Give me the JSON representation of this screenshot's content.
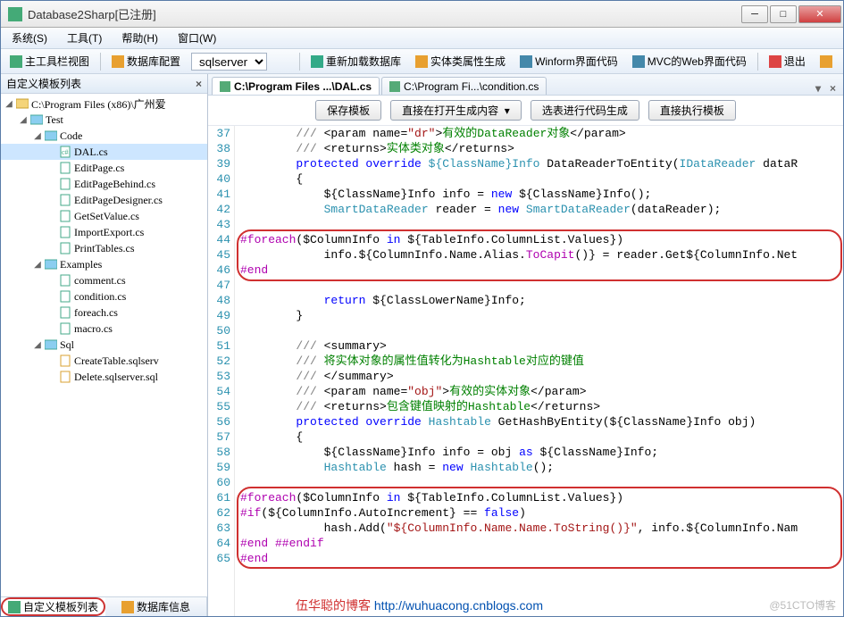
{
  "window": {
    "title": "Database2Sharp[已注册]"
  },
  "menu": [
    "系统(S)",
    "工具(T)",
    "帮助(H)",
    "窗口(W)"
  ],
  "toolbar": {
    "btn1": "主工具栏视图",
    "btn2": "数据库配置",
    "select": "sqlserver",
    "btn3": "重新加载数据库",
    "btn4": "实体类属性生成",
    "btn5": "Winform界面代码",
    "btn6": "MVC的Web界面代码",
    "btn7": "退出"
  },
  "sidebar": {
    "title": "自定义模板列表",
    "tree": {
      "root": "C:\\Program Files (x86)\\广州爱",
      "f1": "Test",
      "f2": "Code",
      "i1": "DAL.cs",
      "i2": "EditPage.cs",
      "i3": "EditPageBehind.cs",
      "i4": "EditPageDesigner.cs",
      "i5": "GetSetValue.cs",
      "i6": "ImportExport.cs",
      "i7": "PrintTables.cs",
      "f3": "Examples",
      "i8": "comment.cs",
      "i9": "condition.cs",
      "i10": "foreach.cs",
      "i11": "macro.cs",
      "f4": "Sql",
      "i12": "CreateTable.sqlserv",
      "i13": "Delete.sqlserver.sql"
    },
    "tab1": "自定义模板列表",
    "tab2": "数据库信息"
  },
  "tabs": {
    "t1": "C:\\Program Files ...\\DAL.cs",
    "t2": "C:\\Program Fi...\\condition.cs"
  },
  "buttons": {
    "b1": "保存模板",
    "b2": "直接在打开生成内容",
    "b3": "选表进行代码生成",
    "b4": "直接执行模板"
  },
  "code": {
    "start": 37,
    "lines": [
      {
        "seg": [
          [
            "        /// ",
            "c-gray"
          ],
          [
            "<param name=",
            ""
          ],
          [
            "\"dr\"",
            "c-str"
          ],
          [
            ">",
            ""
          ],
          [
            "有效的DataReader对象",
            "c-green"
          ],
          [
            "</param>",
            ""
          ]
        ]
      },
      {
        "seg": [
          [
            "        /// ",
            "c-gray"
          ],
          [
            "<returns>",
            ""
          ],
          [
            "实体类对象",
            "c-green"
          ],
          [
            "</returns>",
            ""
          ]
        ]
      },
      {
        "seg": [
          [
            "        ",
            ""
          ],
          [
            "protected override ",
            "c-blue"
          ],
          [
            "${ClassName}Info ",
            "c-type"
          ],
          [
            "DataReaderToEntity(",
            ""
          ],
          [
            "IDataReader ",
            "c-type"
          ],
          [
            "dataR",
            ""
          ]
        ]
      },
      {
        "seg": [
          [
            "        {",
            ""
          ]
        ]
      },
      {
        "seg": [
          [
            "            ${ClassName}Info info = ",
            ""
          ],
          [
            "new ",
            "c-blue"
          ],
          [
            "${ClassName}Info();",
            ""
          ]
        ]
      },
      {
        "seg": [
          [
            "            ",
            ""
          ],
          [
            "SmartDataReader ",
            "c-type"
          ],
          [
            "reader = ",
            ""
          ],
          [
            "new ",
            "c-blue"
          ],
          [
            "SmartDataReader",
            "c-type"
          ],
          [
            "(dataReader);",
            ""
          ]
        ]
      },
      {
        "seg": [
          [
            "",
            ""
          ]
        ]
      },
      {
        "seg": [
          [
            "#foreach",
            "c-mag"
          ],
          [
            "($ColumnInfo ",
            ""
          ],
          [
            "in ",
            "c-blue"
          ],
          [
            "${TableInfo.ColumnList.Values})",
            ""
          ]
        ]
      },
      {
        "seg": [
          [
            "            info.${ColumnInfo.Name.Alias.",
            ""
          ],
          [
            "ToCapit",
            "c-mag"
          ],
          [
            "()} = reader.Get${ColumnInfo.Net",
            ""
          ]
        ]
      },
      {
        "seg": [
          [
            "#end",
            "c-mag"
          ]
        ]
      },
      {
        "seg": [
          [
            "",
            ""
          ]
        ]
      },
      {
        "seg": [
          [
            "            ",
            ""
          ],
          [
            "return ",
            "c-blue"
          ],
          [
            "${ClassLowerName}Info;",
            ""
          ]
        ]
      },
      {
        "seg": [
          [
            "        }",
            ""
          ]
        ]
      },
      {
        "seg": [
          [
            "",
            ""
          ]
        ]
      },
      {
        "seg": [
          [
            "        /// ",
            "c-gray"
          ],
          [
            "<summary>",
            ""
          ]
        ]
      },
      {
        "seg": [
          [
            "        /// ",
            "c-gray"
          ],
          [
            "将实体对象的属性值转化为Hashtable对应的键值",
            "c-green"
          ]
        ]
      },
      {
        "seg": [
          [
            "        /// ",
            "c-gray"
          ],
          [
            "</summary>",
            ""
          ]
        ]
      },
      {
        "seg": [
          [
            "        /// ",
            "c-gray"
          ],
          [
            "<param name=",
            ""
          ],
          [
            "\"obj\"",
            "c-str"
          ],
          [
            ">",
            ""
          ],
          [
            "有效的实体对象",
            "c-green"
          ],
          [
            "</param>",
            ""
          ]
        ]
      },
      {
        "seg": [
          [
            "        /// ",
            "c-gray"
          ],
          [
            "<returns>",
            ""
          ],
          [
            "包含键值映射的Hashtable",
            "c-green"
          ],
          [
            "</returns>",
            ""
          ]
        ]
      },
      {
        "seg": [
          [
            "        ",
            ""
          ],
          [
            "protected override ",
            "c-blue"
          ],
          [
            "Hashtable ",
            "c-type"
          ],
          [
            "GetHashByEntity",
            ""
          ],
          [
            "(${ClassName}Info obj)",
            ""
          ]
        ]
      },
      {
        "seg": [
          [
            "        {",
            ""
          ]
        ]
      },
      {
        "seg": [
          [
            "            ${ClassName}Info info = obj ",
            ""
          ],
          [
            "as ",
            "c-blue"
          ],
          [
            "${ClassName}Info;",
            ""
          ]
        ]
      },
      {
        "seg": [
          [
            "            ",
            ""
          ],
          [
            "Hashtable ",
            "c-type"
          ],
          [
            "hash = ",
            ""
          ],
          [
            "new ",
            "c-blue"
          ],
          [
            "Hashtable",
            "c-type"
          ],
          [
            "();",
            ""
          ]
        ]
      },
      {
        "seg": [
          [
            "",
            ""
          ]
        ]
      },
      {
        "seg": [
          [
            "#foreach",
            "c-mag"
          ],
          [
            "($ColumnInfo ",
            ""
          ],
          [
            "in ",
            "c-blue"
          ],
          [
            "${TableInfo.ColumnList.Values})",
            ""
          ]
        ]
      },
      {
        "seg": [
          [
            "#if",
            "c-mag"
          ],
          [
            "(${ColumnInfo.AutoIncrement} == ",
            ""
          ],
          [
            "false",
            "c-blue"
          ],
          [
            ")",
            ""
          ]
        ]
      },
      {
        "seg": [
          [
            "            hash.Add(",
            ""
          ],
          [
            "\"${ColumnInfo.Name.Name.ToString()}\"",
            "c-str"
          ],
          [
            ", info.${ColumnInfo.Nam",
            ""
          ]
        ]
      },
      {
        "seg": [
          [
            "#end ##endif",
            "c-mag"
          ]
        ]
      },
      {
        "seg": [
          [
            "#end",
            "c-mag"
          ]
        ]
      }
    ]
  },
  "footer": {
    "text": "伍华聪的博客 ",
    "url": "http://wuhuacong.cnblogs.com"
  },
  "watermark": "@51CTO博客"
}
